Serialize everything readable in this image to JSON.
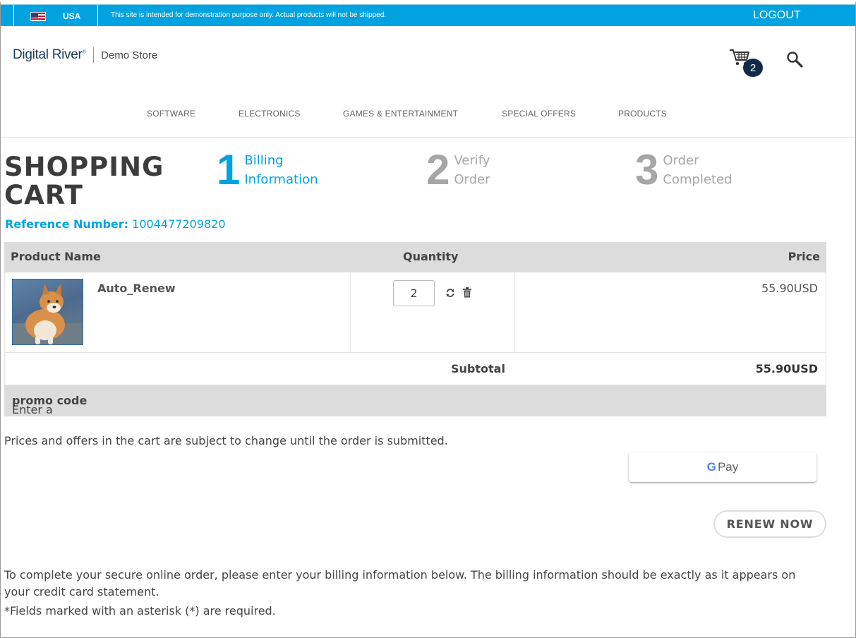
{
  "topbar": {
    "country": "USA",
    "notice": "This site is intended for demonstration purpose only. Actual products will not be shipped.",
    "logout_label": "LOGOUT",
    "color": "#00a3e0"
  },
  "header": {
    "brand_part1": "Digital ",
    "brand_part2": "River",
    "brand_mark": "®",
    "store_label": "Demo Store",
    "cart_count": "2"
  },
  "nav": {
    "items": [
      "SOFTWARE",
      "ELECTRONICS",
      "GAMES & ENTERTAINMENT",
      "SPECIAL OFFERS",
      "PRODUCTS"
    ]
  },
  "cart": {
    "title_line1": "SHOPPING",
    "title_line2": "CART",
    "reference_label": "Reference Number:",
    "reference_number": "1004477209820"
  },
  "steps": [
    {
      "number": "1",
      "line1": "Billing",
      "line2": "Information",
      "state": "active"
    },
    {
      "number": "2",
      "line1": "Verify",
      "line2": "Order",
      "state": "inactive"
    },
    {
      "number": "3",
      "line1": "Order",
      "line2": "Completed",
      "state": "inactive"
    }
  ],
  "table": {
    "headers": {
      "name": "Product Name",
      "quantity": "Quantity",
      "price": "Price"
    },
    "items": [
      {
        "name": "Auto_Renew",
        "quantity": "2",
        "price": "55.90USD",
        "image": "shiba-dog-photo"
      }
    ],
    "subtotal_label": "Subtotal",
    "subtotal_value": "55.90USD",
    "promo_prefix": "Enter a ",
    "promo_bold": "promo code"
  },
  "footer": {
    "disclaimer": "Prices and offers in the cart are subject to change until the order is submitted.",
    "gpay_g": "G",
    "gpay_label": "Pay",
    "renew_label": "RENEW NOW",
    "billing_info": "To complete your secure online order, please enter your billing information below. The billing information should be exactly as it appears on your credit card statement.",
    "required_note": "*Fields marked with an asterisk (*) are required."
  },
  "colors": {
    "accent": "#00a3e0",
    "badge": "#102a4a",
    "table_header_bg": "#dcdcdc",
    "step_inactive": "#a6a6a6"
  }
}
